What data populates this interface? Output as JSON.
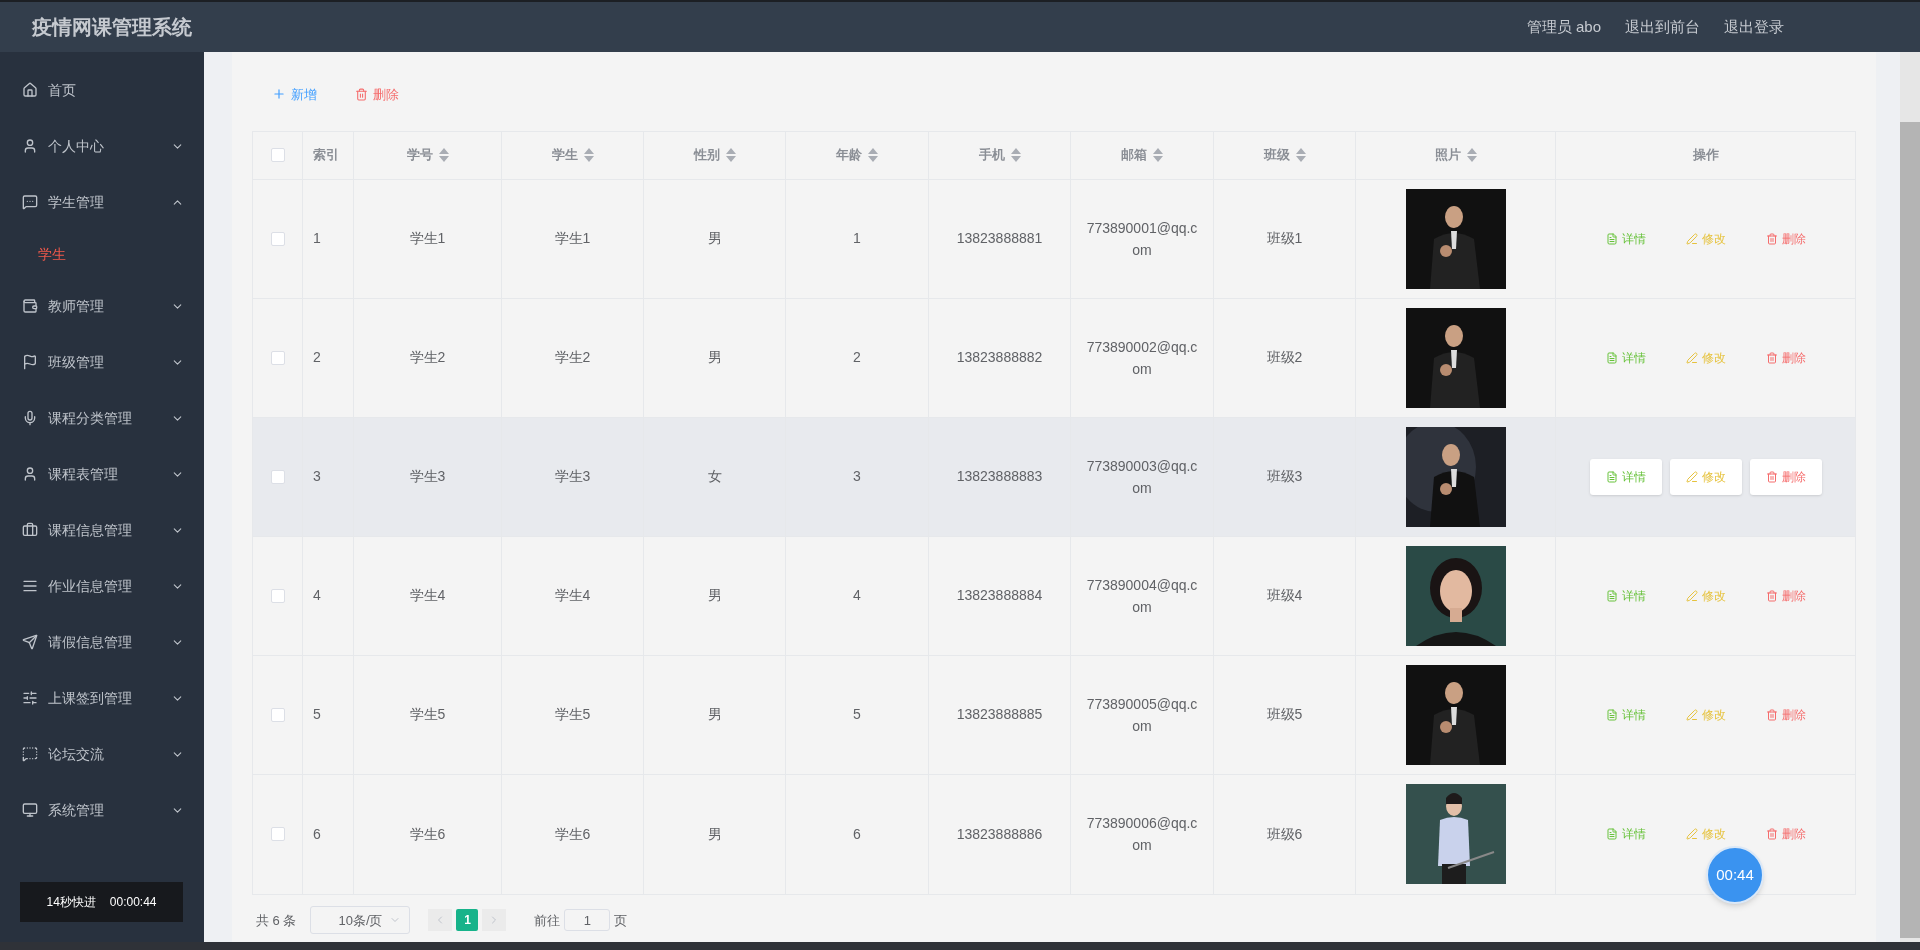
{
  "header": {
    "title": "疫情网课管理系统",
    "links": [
      "管理员 abo",
      "退出到前台",
      "退出登录"
    ]
  },
  "sidebar": {
    "items": [
      {
        "label": "首页",
        "expandable": false
      },
      {
        "label": "个人中心",
        "expandable": true,
        "expanded": false
      },
      {
        "label": "学生管理",
        "expandable": true,
        "expanded": true,
        "children": [
          {
            "label": "学生",
            "selected": true
          }
        ]
      },
      {
        "label": "教师管理",
        "expandable": true,
        "expanded": false
      },
      {
        "label": "班级管理",
        "expandable": true,
        "expanded": false
      },
      {
        "label": "课程分类管理",
        "expandable": true,
        "expanded": false
      },
      {
        "label": "课程表管理",
        "expandable": true,
        "expanded": false
      },
      {
        "label": "课程信息管理",
        "expandable": true,
        "expanded": false
      },
      {
        "label": "作业信息管理",
        "expandable": true,
        "expanded": false
      },
      {
        "label": "请假信息管理",
        "expandable": true,
        "expanded": false
      },
      {
        "label": "上课签到管理",
        "expandable": true,
        "expanded": false
      },
      {
        "label": "论坛交流",
        "expandable": true,
        "expanded": false
      },
      {
        "label": "系统管理",
        "expandable": true,
        "expanded": false
      }
    ]
  },
  "recorder": {
    "label": "14秒快进",
    "time": "00:00:44",
    "bubble": "00:44"
  },
  "toolbar": {
    "add": "新增",
    "delete": "删除"
  },
  "table": {
    "select_all_checked": false,
    "columns": [
      {
        "label": "索引",
        "sortable": false
      },
      {
        "label": "学号",
        "sortable": true
      },
      {
        "label": "学生",
        "sortable": true
      },
      {
        "label": "性别",
        "sortable": true
      },
      {
        "label": "年龄",
        "sortable": true
      },
      {
        "label": "手机",
        "sortable": true
      },
      {
        "label": "邮箱",
        "sortable": true
      },
      {
        "label": "班级",
        "sortable": true
      },
      {
        "label": "照片",
        "sortable": true
      },
      {
        "label": "操作",
        "sortable": false
      }
    ],
    "rows": [
      {
        "checked": false,
        "hovered": false,
        "cells": [
          "1",
          "学生1",
          "学生1",
          "男",
          "1",
          "13823888881",
          "773890001@qq.com",
          "班级1"
        ],
        "actions": [
          "详情",
          "修改",
          "删除"
        ]
      },
      {
        "checked": false,
        "hovered": false,
        "cells": [
          "2",
          "学生2",
          "学生2",
          "男",
          "2",
          "13823888882",
          "773890002@qq.com",
          "班级2"
        ],
        "actions": [
          "详情",
          "修改",
          "删除"
        ]
      },
      {
        "checked": false,
        "hovered": true,
        "cells": [
          "3",
          "学生3",
          "学生3",
          "女",
          "3",
          "13823888883",
          "773890003@qq.com",
          "班级3"
        ],
        "actions": [
          "详情",
          "修改",
          "删除"
        ]
      },
      {
        "checked": false,
        "hovered": false,
        "cells": [
          "4",
          "学生4",
          "学生4",
          "男",
          "4",
          "13823888884",
          "773890004@qq.com",
          "班级4"
        ],
        "actions": [
          "详情",
          "修改",
          "删除"
        ]
      },
      {
        "checked": false,
        "hovered": false,
        "cells": [
          "5",
          "学生5",
          "学生5",
          "男",
          "5",
          "13823888885",
          "773890005@qq.com",
          "班级5"
        ],
        "actions": [
          "详情",
          "修改",
          "删除"
        ]
      },
      {
        "checked": false,
        "hovered": false,
        "cells": [
          "6",
          "学生6",
          "学生6",
          "男",
          "6",
          "13823888886",
          "773890006@qq.com",
          "班级6"
        ],
        "actions": [
          "详情",
          "修改",
          "删除"
        ]
      }
    ]
  },
  "pagination": {
    "total": "共 6 条",
    "page_size": "10条/页",
    "pages": [
      {
        "label": "1",
        "selected": true
      }
    ],
    "goto_label": "前往",
    "goto_value": "1",
    "goto_suffix": "页"
  }
}
